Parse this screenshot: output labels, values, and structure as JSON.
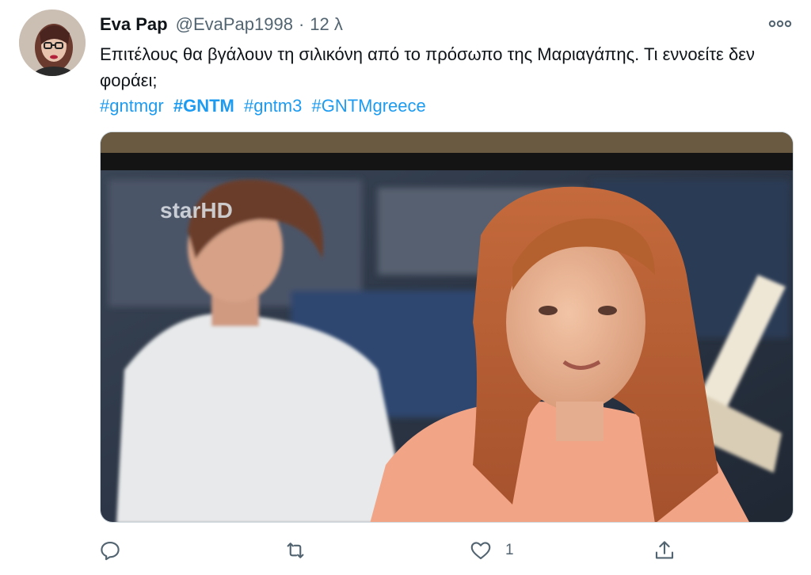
{
  "tweet": {
    "author_name": "Eva Pap",
    "handle": "@EvaPap1998",
    "separator": "·",
    "time": "12 λ",
    "text": "Επιτέλους θα βγάλουν τη σιλικόνη από το πρόσωπο της Μαριαγάπης. Τι εννοείτε δεν φοράει;",
    "hashtags": [
      "#gntmgr",
      "#GNTM",
      "#gntm3",
      "#GNTMgreece"
    ],
    "media_watermark": "starHD"
  },
  "actions": {
    "reply_count": "",
    "retweet_count": "",
    "like_count": "1",
    "share_count": ""
  },
  "icons": {
    "more": "more-dots-icon",
    "reply": "reply-icon",
    "retweet": "retweet-icon",
    "like": "heart-icon",
    "share": "share-icon"
  },
  "colors": {
    "link": "#1d9bf0",
    "secondary_text": "#536471",
    "primary_text": "#0f1419"
  }
}
